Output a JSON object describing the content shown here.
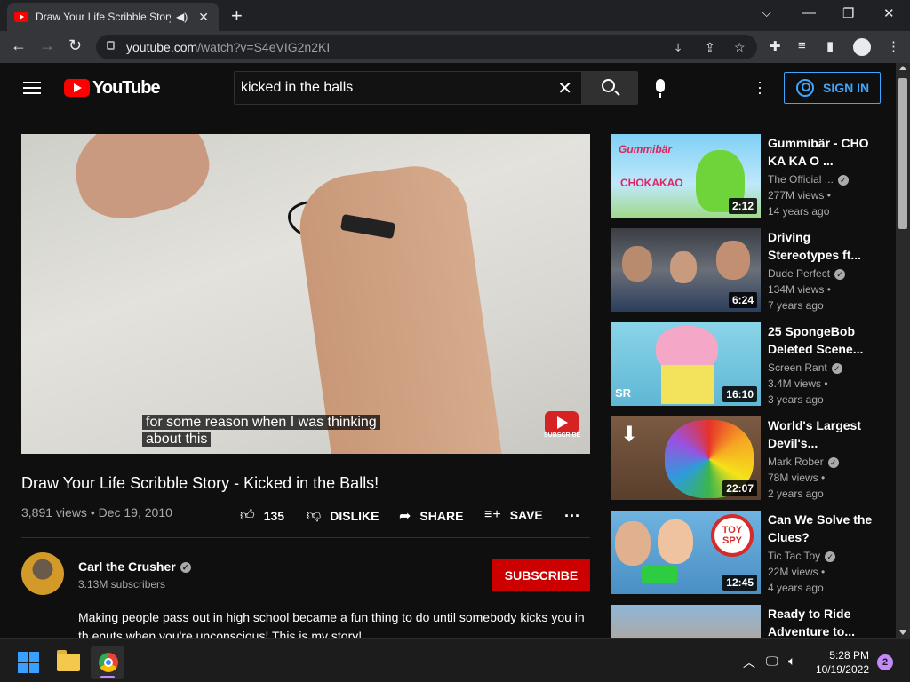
{
  "browser": {
    "tab_title": "Draw Your Life Scribble Story",
    "new_tab": "+",
    "url_host": "youtube.com",
    "url_path": "/watch?v=S4eVIG2n2KI",
    "window_controls": {
      "chevron": "⌵",
      "minimize": "—",
      "restore": "❐",
      "close": "✕"
    }
  },
  "masthead": {
    "logo_text": "YouTube",
    "search_query": "kicked in the balls",
    "sign_in": "SIGN IN"
  },
  "player": {
    "caption_line1": "for some reason when I was thinking",
    "caption_line2": "about this",
    "watermark_text": "SUBSCRIBE"
  },
  "video": {
    "title": "Draw Your Life Scribble Story - Kicked in the Balls!",
    "meta": "3,891 views • Dec 19, 2010",
    "likes": "135",
    "dislike": "DISLIKE",
    "share": "SHARE",
    "save": "SAVE"
  },
  "channel": {
    "name": "Carl the Crusher",
    "subscribers": "3.13M subscribers",
    "subscribe": "SUBSCRIBE"
  },
  "description": "Making people pass out in high school became a fun thing to do until somebody kicks you in th enuts when you're unconscious! This is my story!",
  "recommendations": [
    {
      "title": "Gummibär - CHO KA KA O ...",
      "channel": "The Official ...",
      "views": "277M views •",
      "ago": "14 years ago",
      "duration": "2:12"
    },
    {
      "title": "Driving Stereotypes ft...",
      "channel": "Dude Perfect",
      "views": "134M views •",
      "ago": "7 years ago",
      "duration": "6:24"
    },
    {
      "title": "25 SpongeBob Deleted Scene...",
      "channel": "Screen Rant",
      "views": "3.4M views •",
      "ago": "3 years ago",
      "duration": "16:10"
    },
    {
      "title": "World's Largest Devil's...",
      "channel": "Mark Rober",
      "views": "78M views •",
      "ago": "2 years ago",
      "duration": "22:07"
    },
    {
      "title": "Can We Solve the Clues?",
      "channel": "Tic Tac Toy",
      "views": "22M views •",
      "ago": "4 years ago",
      "duration": "12:45"
    },
    {
      "title": "Ready to Ride Adventure to...",
      "channel": "",
      "views": "",
      "ago": "",
      "duration": ""
    }
  ],
  "thumb_text": {
    "gummibar_logo": "Gummibär",
    "chokakao": "CHOKAKAO",
    "sr_logo": "SR",
    "toy_spy": "TOY SPY"
  },
  "taskbar": {
    "time": "5:28 PM",
    "date": "10/19/2022",
    "notifications": "2"
  }
}
